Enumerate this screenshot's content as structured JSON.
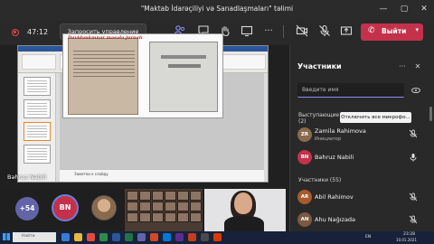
{
  "window": {
    "title": "\"Maktab İdarəçiliyi və Sanadlaşmaları\" təlimi",
    "controls": [
      "—",
      "▢",
      "✕"
    ]
  },
  "toolbar": {
    "timer": "47:12",
    "request_control": "Запросить управление",
    "leave": "Выйти"
  },
  "stage": {
    "presenter_name": "Bəhruz Nabili",
    "slide_heading": "Davidənkmnər məsələ jurnalı",
    "notes": "Заметки к слайду"
  },
  "gallery": {
    "more_count": "+54",
    "avatar_initials": "BN"
  },
  "panel": {
    "title": "Участники",
    "search_placeholder": "Введите имя",
    "presenters_label": "Выступающие",
    "presenters_count": "(2)",
    "mute_all_tooltip": "Отключить все микрофо...",
    "participants_label": "Участники (55)",
    "presenters": [
      {
        "name": "Zamila Rahimova",
        "role": "Инициатор",
        "initials": "ZR",
        "color": "#8a6a4d"
      },
      {
        "name": "Bəhruz Nabili",
        "role": "",
        "initials": "BN",
        "color": "#c4314b"
      }
    ],
    "participants": [
      {
        "name": "Abil Rahimov",
        "initials": "AR",
        "color": "#a85a2c"
      },
      {
        "name": "Ahu Nağızadə",
        "initials": "AN",
        "color": "#7a5a42"
      }
    ]
  },
  "taskbar": {
    "search_placeholder": "Найти",
    "lang": "EN",
    "time": "23:28",
    "date": "10.01.2021"
  },
  "colors": {
    "accent": "#6264a7",
    "leave": "#c4314b",
    "panel_bg": "#292929"
  }
}
